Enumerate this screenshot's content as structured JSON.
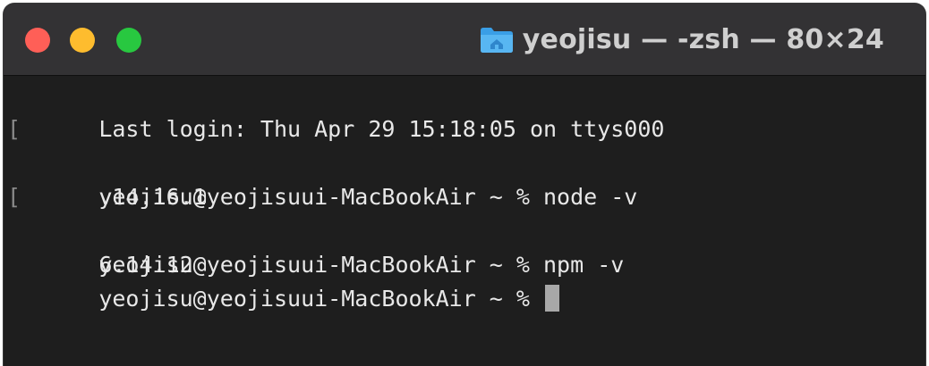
{
  "window": {
    "title": "yeojisu — -zsh — 80×24",
    "title_icon": "home-folder-icon",
    "traffic_lights": {
      "close_color": "#ff5f57",
      "minimize_color": "#febc2e",
      "zoom_color": "#28c840"
    }
  },
  "terminal": {
    "lines": [
      {
        "text": "Last login: Thu Apr 29 15:18:05 on ttys000",
        "bracket": false
      },
      {
        "text": "yeojisu@yeojisuui-MacBookAir ~ % node -v",
        "bracket": true
      },
      {
        "text": "v14.16.1",
        "bracket": false
      },
      {
        "text": "yeojisu@yeojisuui-MacBookAir ~ % npm -v",
        "bracket": true
      },
      {
        "text": "6.14.12",
        "bracket": false
      }
    ],
    "prompt": "yeojisu@yeojisuui-MacBookAir ~ % ",
    "bracket_char": "["
  }
}
